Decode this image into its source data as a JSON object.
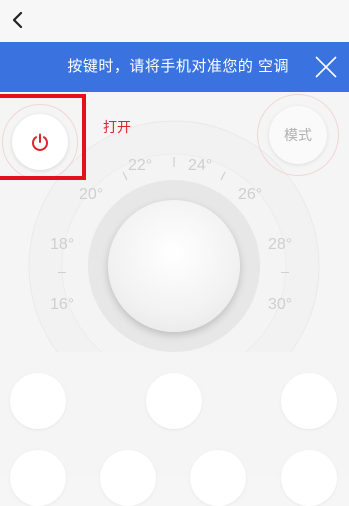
{
  "banner": {
    "text": "按键时，请将手机对准您的 空调"
  },
  "power": {
    "label": "打开"
  },
  "mode": {
    "label": "模式"
  },
  "temperatures": {
    "t16": "16°",
    "t18": "18°",
    "t20": "20°",
    "t22": "22°",
    "t24": "24°",
    "t26": "26°",
    "t28": "28°",
    "t30": "30°"
  },
  "colors": {
    "banner_bg": "#3a73e0",
    "power_red": "#d9262d",
    "highlight_border": "#e4101c"
  },
  "icons": {
    "back": "chevron-left-icon",
    "close": "close-icon",
    "power": "power-icon"
  }
}
